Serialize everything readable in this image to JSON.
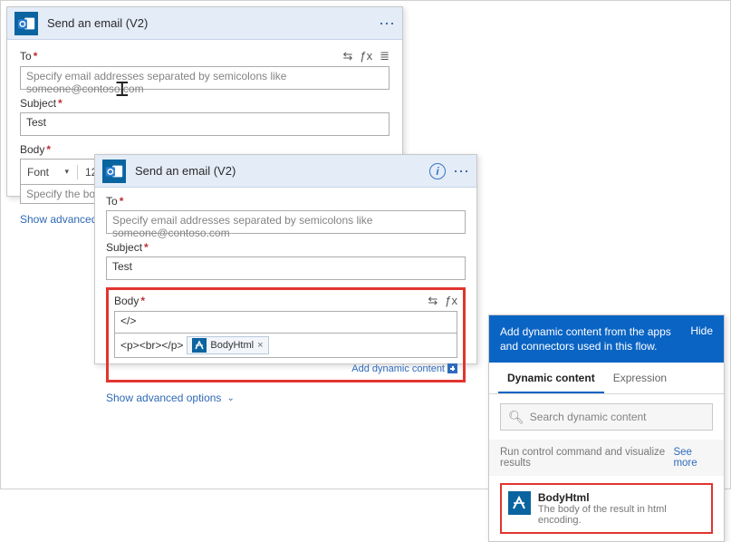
{
  "card1": {
    "title": "Send an email (V2)",
    "to": {
      "label": "To",
      "placeholder": "Specify email addresses separated by semicolons like someone@contoso.com"
    },
    "subject": {
      "label": "Subject",
      "value": "Test"
    },
    "body": {
      "label": "Body",
      "placeholder": "Specify the body of the"
    },
    "rte": {
      "font": "Font",
      "size": "12"
    },
    "advanced": "Show advanced options"
  },
  "card2": {
    "title": "Send an email (V2)",
    "to": {
      "label": "To",
      "placeholder": "Specify email addresses separated by semicolons like someone@contoso.com"
    },
    "subject": {
      "label": "Subject",
      "value": "Test"
    },
    "body": {
      "label": "Body",
      "editor_text": "</>",
      "tag_prefix": "<p><br></p>",
      "token": "BodyHtml"
    },
    "add_dynamic": "Add dynamic content",
    "advanced": "Show advanced options"
  },
  "panel": {
    "header": "Add dynamic content from the apps and connectors used in this flow.",
    "hide": "Hide",
    "tabs": {
      "dynamic": "Dynamic content",
      "expression": "Expression"
    },
    "search_placeholder": "Search dynamic content",
    "section": "Run control command and visualize results",
    "see_more": "See more",
    "item": {
      "title": "BodyHtml",
      "desc": "The body of the result in html encoding."
    }
  },
  "icons": {
    "fx": "ƒx"
  }
}
